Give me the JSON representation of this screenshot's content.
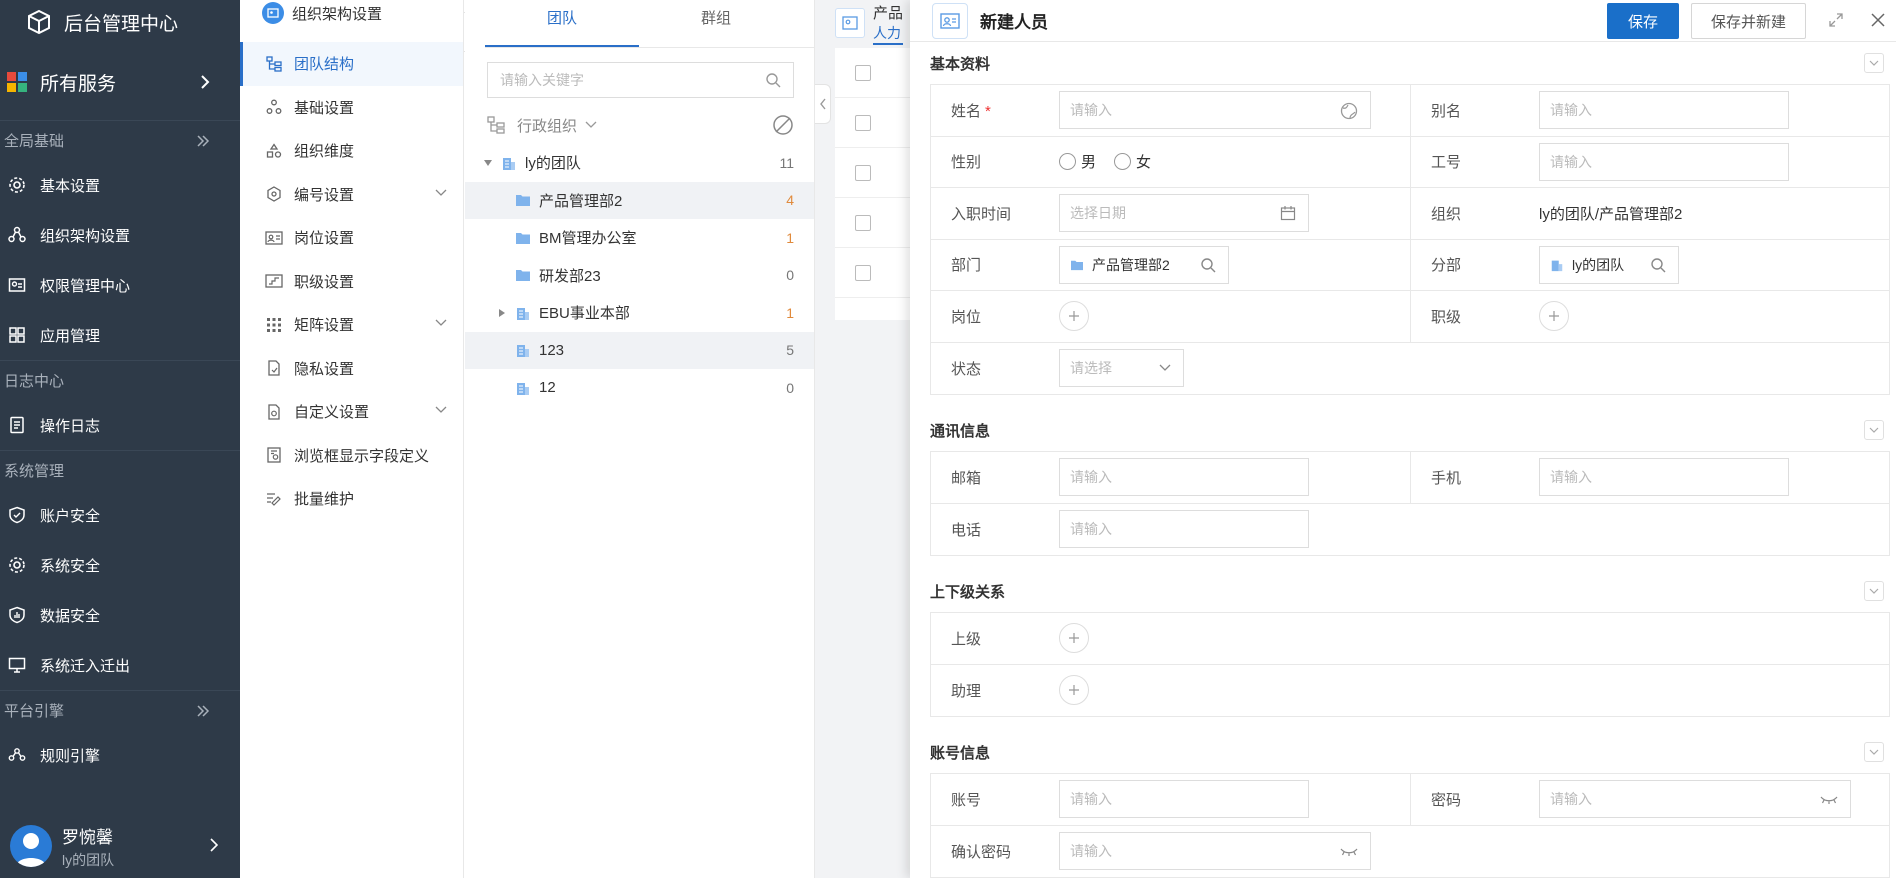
{
  "sidebar": {
    "brand": "后台管理中心",
    "services": "所有服务",
    "groups": {
      "global": "全局基础",
      "log": "日志中心",
      "system": "系统管理",
      "engine": "平台引擎"
    },
    "items": {
      "basic": "基本设置",
      "org": "组织架构设置",
      "perm": "权限管理中心",
      "app": "应用管理",
      "oplog": "操作日志",
      "account_sec": "账户安全",
      "sys_sec": "系统安全",
      "data_sec": "数据安全",
      "migrate": "系统迁入迁出",
      "rule": "规则引擎"
    },
    "user": {
      "name": "罗惋馨",
      "team": "ly的团队"
    }
  },
  "menu2": {
    "header": "组织架构设置",
    "items": [
      "团队结构",
      "基础设置",
      "组织维度",
      "编号设置",
      "岗位设置",
      "职级设置",
      "矩阵设置",
      "隐私设置",
      "自定义设置",
      "浏览框显示字段定义",
      "批量维护"
    ]
  },
  "tree": {
    "tabs": [
      "团队",
      "群组"
    ],
    "search_placeholder": "请输入关键字",
    "filter_label": "行政组织",
    "nodes": [
      {
        "label": "ly的团队",
        "count": "11"
      },
      {
        "label": "产品管理部2",
        "count": "4"
      },
      {
        "label": "BM管理办公室",
        "count": "1"
      },
      {
        "label": "研发部23",
        "count": "0"
      },
      {
        "label": "EBU事业本部",
        "count": "1"
      },
      {
        "label": "123",
        "count": "5"
      },
      {
        "label": "12",
        "count": "0"
      }
    ]
  },
  "bg": {
    "title": "产品",
    "subtitle": "人力"
  },
  "drawer": {
    "title": "新建人员",
    "save": "保存",
    "save_new": "保存并新建",
    "sections": {
      "basic": "基本资料",
      "contact": "通讯信息",
      "relation": "上下级关系",
      "account": "账号信息"
    },
    "labels": {
      "name": "姓名",
      "alias": "别名",
      "gender": "性别",
      "empno": "工号",
      "entry": "入职时间",
      "org": "组织",
      "dept": "部门",
      "branch": "分部",
      "post": "岗位",
      "grade": "职级",
      "status": "状态",
      "email": "邮箱",
      "mobile": "手机",
      "phone": "电话",
      "superior": "上级",
      "assistant": "助理",
      "account": "账号",
      "password": "密码",
      "confirm": "确认密码"
    },
    "placeholders": {
      "input": "请输入",
      "date": "选择日期",
      "select": "请选择"
    },
    "gender_options": [
      "男",
      "女"
    ],
    "org_value": "ly的团队/产品管理部2",
    "dept_value": "产品管理部2",
    "branch_value": "ly的团队"
  }
}
